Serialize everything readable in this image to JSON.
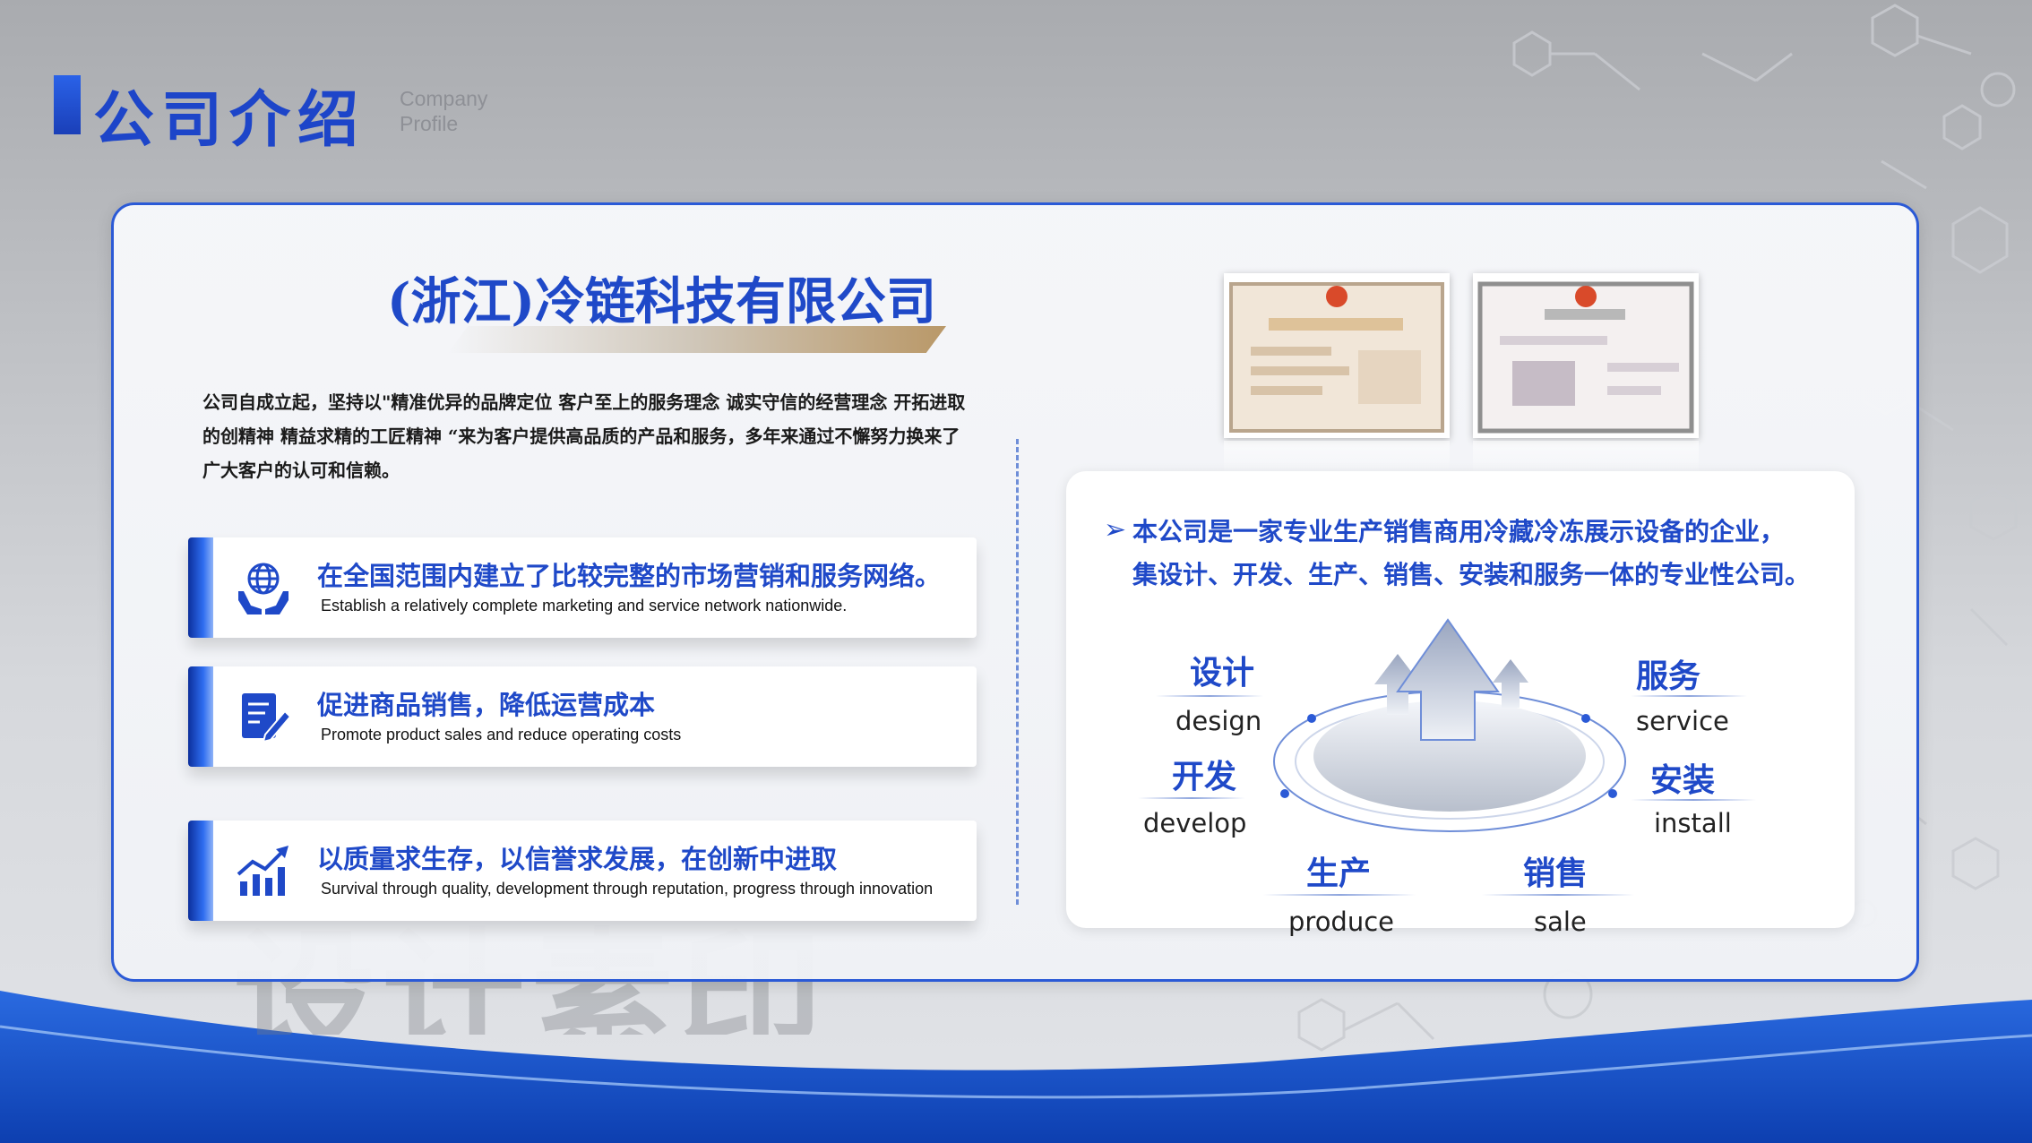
{
  "header": {
    "title": "公司介绍",
    "subtitle_line1": "Company",
    "subtitle_line2": "Profile"
  },
  "company": {
    "name": "(浙江)冷链科技有限公司",
    "intro": "公司自成立起，坚持以\"精准优异的品牌定位 客户至上的服务理念 诚实守信的经营理念 开拓进取的创精神 精益求精的工匠精神 “来为客户提供高品质的产品和服务，多年来通过不懈努力换来了广大客户的认可和信赖。"
  },
  "features": [
    {
      "icon": "globe-hands-icon",
      "cn": "在全国范围内建立了比较完整的市场营销和服务网络。",
      "en": "Establish a relatively complete marketing and service network nationwide."
    },
    {
      "icon": "document-edit-icon",
      "cn": "促进商品销售，降低运营成本",
      "en": "Promote product sales and reduce operating costs"
    },
    {
      "icon": "growth-chart-icon",
      "cn": "以质量求生存，以信誉求发展，在创新中进取",
      "en": "Survival through quality, development through reputation,  progress through innovation"
    }
  ],
  "panel": {
    "line1": "本公司是一家专业生产销售商用冷藏冷冻展示设备的企业，",
    "line2": "集设计、开发、生产、销售、安装和服务一体的专业性公司。"
  },
  "services": [
    {
      "cn": "设计",
      "en": "design"
    },
    {
      "cn": "开发",
      "en": "develop"
    },
    {
      "cn": "生产",
      "en": "produce"
    },
    {
      "cn": "销售",
      "en": "sale"
    },
    {
      "cn": "安装",
      "en": "install"
    },
    {
      "cn": "服务",
      "en": "service"
    }
  ],
  "watermark": "设计素印",
  "colors": {
    "accent": "#1f49c8",
    "border": "#2b5ad6",
    "wave": "#1450c8"
  }
}
